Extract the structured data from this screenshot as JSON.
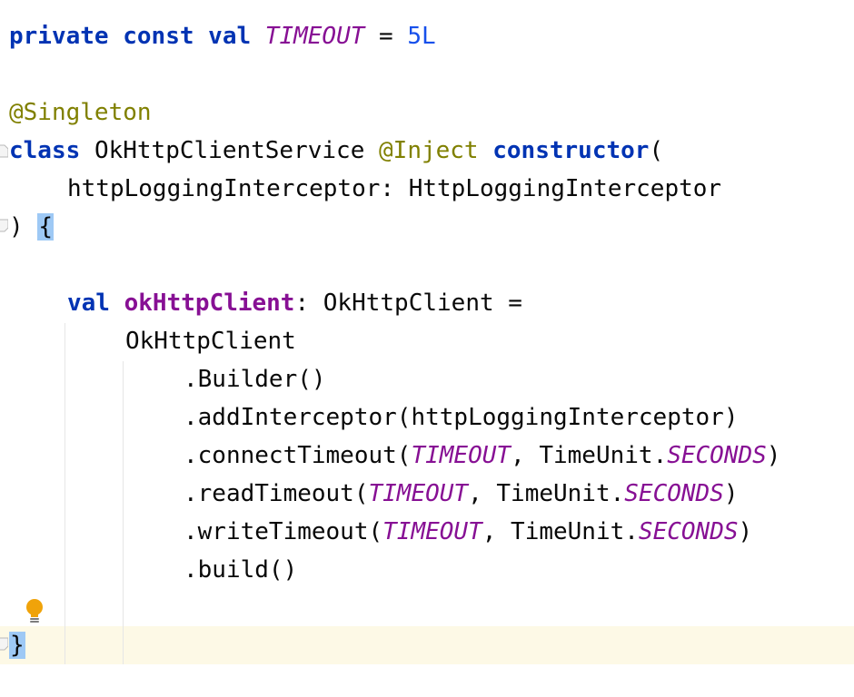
{
  "code": {
    "line1": {
      "kw_private": "private",
      "kw_const": "const",
      "kw_val": "val",
      "const_name": "TIMEOUT",
      "equals": "=",
      "value": "5L"
    },
    "line3": {
      "annotation": "@Singleton"
    },
    "line4": {
      "kw_class": "class",
      "class_name": "OkHttpClientService",
      "annotation": "@Inject",
      "kw_constructor": "constructor",
      "paren": "("
    },
    "line5": {
      "param_name": "httpLoggingInterceptor",
      "colon": ":",
      "param_type": "HttpLoggingInterceptor"
    },
    "line6": {
      "close_paren": ")",
      "open_brace": "{"
    },
    "line8": {
      "kw_val": "val",
      "prop_name": "okHttpClient",
      "colon": ":",
      "type": "OkHttpClient",
      "equals": "="
    },
    "line9": {
      "text": "OkHttpClient"
    },
    "line10": {
      "text": ".Builder()"
    },
    "line11": {
      "text": ".addInterceptor(httpLoggingInterceptor)"
    },
    "line12": {
      "call": ".connectTimeout(",
      "const": "TIMEOUT",
      "mid": ", TimeUnit.",
      "unit": "SECONDS",
      "close": ")"
    },
    "line13": {
      "call": ".readTimeout(",
      "const": "TIMEOUT",
      "mid": ", TimeUnit.",
      "unit": "SECONDS",
      "close": ")"
    },
    "line14": {
      "call": ".writeTimeout(",
      "const": "TIMEOUT",
      "mid": ", TimeUnit.",
      "unit": "SECONDS",
      "close": ")"
    },
    "line15": {
      "text": ".build()"
    },
    "line17": {
      "close_brace": "}"
    }
  },
  "icons": {
    "intention": "lightbulb-icon",
    "fold": "fold-marker-icon"
  },
  "colors": {
    "keyword": "#0033b3",
    "annotation": "#808000",
    "constant": "#871094",
    "number": "#1750eb",
    "brace_highlight": "#9ec9f5",
    "current_line": "#fdf9e6",
    "bulb": "#f0a30a"
  }
}
